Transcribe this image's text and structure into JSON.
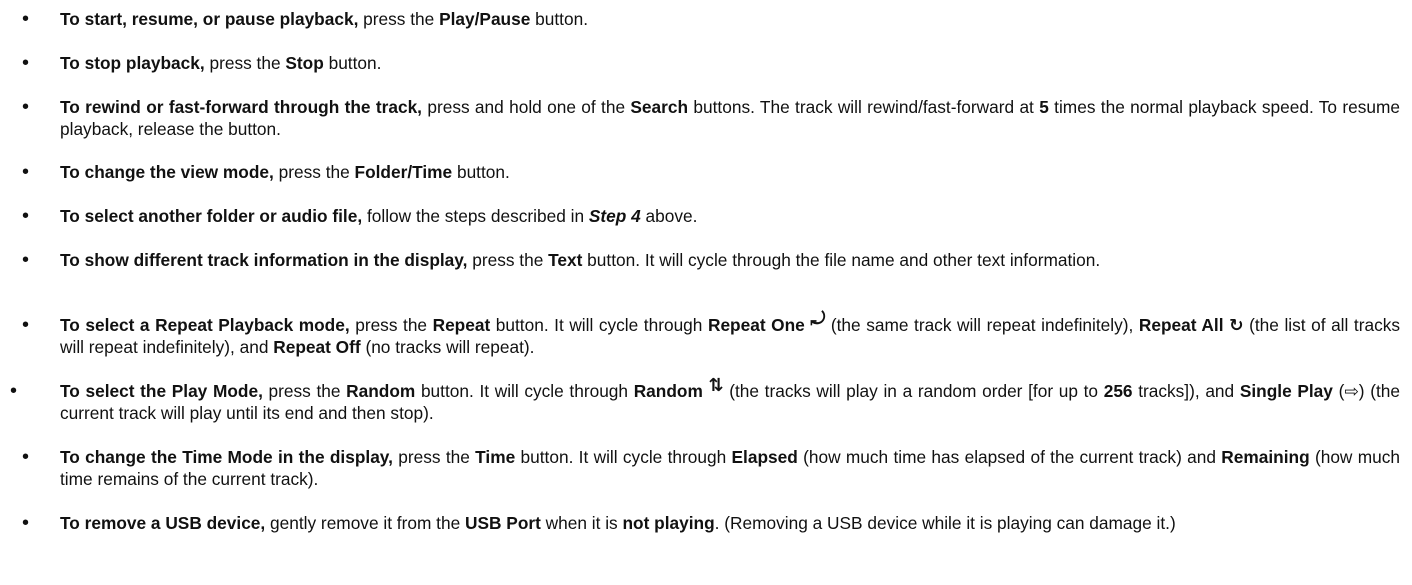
{
  "bullet_glyph": "•",
  "items": [
    {
      "bold": "To start, resume, or pause playback,",
      "t1": " press the ",
      "b1": "Play/Pause",
      "t2": " button."
    },
    {
      "bold": "To stop playback,",
      "t1": " press the ",
      "b1": "Stop",
      "t2": " button."
    },
    {
      "bold": "To rewind or fast-forward through the track,",
      "t1": " press and hold one of the ",
      "b1": "Search",
      "t2": " buttons. The track will rewind/fast-forward at ",
      "b2": "5",
      "t3": " times the normal playback speed. To resume playback, release the button."
    },
    {
      "bold": "To change the view mode,",
      "t1": " press the ",
      "b1": "Folder/Time",
      "t2": " button."
    },
    {
      "bold": "To select another folder or audio file,",
      "t1": " follow the steps described in ",
      "bi1": "Step 4",
      "t2": " above."
    },
    {
      "bold": "To show different track information in the display,",
      "t1": " press the ",
      "b1": "Text",
      "t2": " button. It will cycle through the file name and other text information."
    },
    {
      "bold": "To select a Repeat Playback mode,",
      "t1": " press the ",
      "b1": "Repeat",
      "t2": " button. It will cycle through ",
      "b2": "Repeat One",
      "icon1": "⤾",
      "t3": " (the same track will repeat indefinitely), ",
      "b3": "Repeat All",
      "icon2": "↻",
      "t4": " (the list of all tracks will repeat indefinitely), and ",
      "b4": "Repeat Off",
      "t5": " (no tracks will repeat)."
    },
    {
      "bold": "To select the Play Mode,",
      "t1": " press the ",
      "b1": "Random",
      "t2": " button. It will cycle through ",
      "b2": "Random",
      "icon1": "⇅",
      "t3": " (the tracks will play in a random order [for up to ",
      "b3": "256",
      "t4": " tracks]), and ",
      "b4": "Single Play",
      "t5": " (⇨) (the current track will play until its end and then stop)."
    },
    {
      "bold": "To change the Time Mode in the display,",
      "t1": " press the ",
      "b1": "Time",
      "t2": " button. It will cycle through ",
      "b2": "Elapsed",
      "t3": " (how much time has elapsed of the current track) and ",
      "b3": "Remaining",
      "t4": " (how much time remains of the current track)."
    },
    {
      "bold": "To remove a USB device,",
      "t1": " gently remove it from the ",
      "b1": "USB Port",
      "t2": " when it is ",
      "b2": "not playing",
      "t3": ". (Removing a USB device while it is playing can damage it.)"
    }
  ]
}
